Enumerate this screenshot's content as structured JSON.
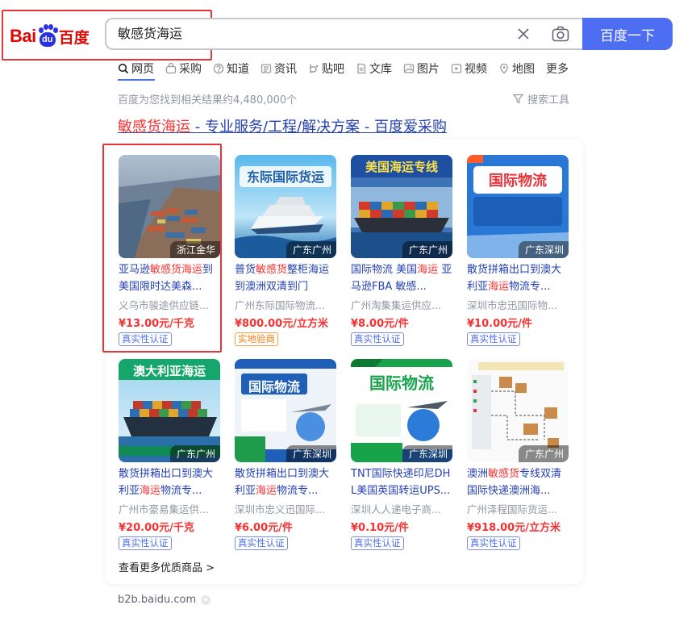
{
  "header": {
    "logo_bai": "Bai",
    "logo_du": "du",
    "logo_cn": "百度",
    "search_query": "敏感货海运",
    "search_button": "百度一下"
  },
  "tabs": [
    {
      "label": "网页",
      "icon": "search-icon",
      "active": true
    },
    {
      "label": "采购",
      "icon": "basket-icon"
    },
    {
      "label": "知道",
      "icon": "question-icon"
    },
    {
      "label": "资讯",
      "icon": "news-icon"
    },
    {
      "label": "贴吧",
      "icon": "tieba-icon"
    },
    {
      "label": "文库",
      "icon": "document-icon"
    },
    {
      "label": "图片",
      "icon": "image-icon"
    },
    {
      "label": "视频",
      "icon": "video-icon"
    },
    {
      "label": "地图",
      "icon": "map-icon"
    },
    {
      "label": "更多",
      "icon": ""
    }
  ],
  "result_count": "百度为您找到相关结果约4,480,000个",
  "search_tools": "搜索工具",
  "result": {
    "title_highlight": "敏感货海运",
    "title_rest": " - 专业服务/工程/解决方案 - 百度爱采购"
  },
  "products": [
    {
      "location": "浙江金华",
      "title_pre": "亚马逊",
      "title_hl": "敏感货海运",
      "title_post": "到美国限时达美森...",
      "seller": "义乌市骏途供应链...",
      "price": "¥13.00元/千克",
      "badge": "真实性认证",
      "badge_style": "blue",
      "thumb_text": "",
      "thumb_theme": "port"
    },
    {
      "location": "广东广州",
      "title_pre": "普货",
      "title_hl": "敏感货",
      "title_post": "整柜海运到澳洲双清到门",
      "seller": "广州东际国际物流...",
      "price": "¥800.00元/立方米",
      "badge": "实地验商",
      "badge_style": "orange",
      "thumb_text": "东际国际货运",
      "thumb_theme": "cruise"
    },
    {
      "location": "广东广州",
      "title_pre": "国际物流 美国",
      "title_hl": "海运",
      "title_post": " 亚马逊FBA 敏感...",
      "seller": "广州淘集集运供应...",
      "price": "¥8.00元/件",
      "badge": "真实性认证",
      "badge_style": "blue",
      "thumb_text": "美国海运专线",
      "thumb_theme": "container"
    },
    {
      "location": "广东深圳",
      "title_pre": "散货拼箱出口到澳大利亚",
      "title_hl": "海运",
      "title_post": "物流专...",
      "seller": "深圳市忠迅国际物...",
      "price": "¥10.00元/件",
      "badge": "真实性认证",
      "badge_style": "blue",
      "thumb_text": "国际物流",
      "thumb_theme": "poster-blue"
    },
    {
      "location": "广东广州",
      "title_pre": "散货拼箱出口到澳大利亚",
      "title_hl": "海运",
      "title_post": "物流专...",
      "seller": "广州市豪易集运供...",
      "price": "¥20.00元/千克",
      "badge": "真实性认证",
      "badge_style": "blue",
      "thumb_text": "澳大利亚海运",
      "thumb_theme": "ship-green"
    },
    {
      "location": "广东深圳",
      "title_pre": "散货拼箱出口到澳大利亚",
      "title_hl": "海运",
      "title_post": "物流专...",
      "seller": "深圳市忠义迅国际...",
      "price": "¥6.00元/件",
      "badge": "真实性认证",
      "badge_style": "blue",
      "thumb_text": "国际物流",
      "thumb_theme": "poster-light"
    },
    {
      "location": "广东深圳",
      "title_pre": "TNT国际快递印尼DHL美国英国转运UPS...",
      "title_hl": "",
      "title_post": "",
      "seller": "深圳人人递电子商...",
      "price": "¥0.10元/件",
      "badge": "真实性认证",
      "badge_style": "blue",
      "thumb_text": "国际物流",
      "thumb_theme": "poster-green"
    },
    {
      "location": "广东广州",
      "title_pre": "澳洲",
      "title_hl": "敏感货",
      "title_post": "专线双清国际快递澳洲海...",
      "seller": "广州泽程国际货运...",
      "price": "¥918.00元/立方米",
      "badge": "真实性认证",
      "badge_style": "blue",
      "thumb_text": "",
      "thumb_theme": "diagram"
    }
  ],
  "more_link": "查看更多优质商品 >",
  "domain": "b2b.baidu.com",
  "colors": {
    "brand_blue": "#4e6ef2",
    "highlight_red": "#f73131",
    "link_blue": "#2440b3",
    "annotation_red": "#e8343b"
  }
}
